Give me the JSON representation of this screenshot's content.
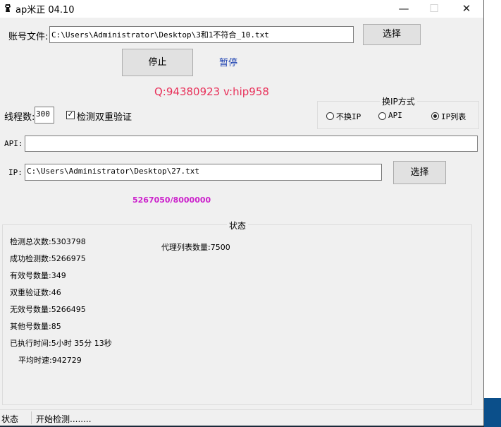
{
  "window": {
    "title": "ap米正 04.10",
    "minimize": "—",
    "maximize": "☐",
    "close": "✕"
  },
  "account": {
    "label": "账号文件:",
    "path": "C:\\Users\\Administrator\\Desktop\\3和1不符合_10.txt",
    "browse_button": "选择"
  },
  "controls": {
    "stop_button": "停止",
    "pause_link": "暂停"
  },
  "contact": "Q:94380923 v:hip958",
  "threads": {
    "label": "线程数:",
    "value": "300"
  },
  "double_verify": {
    "label": "检测双重验证",
    "checked": true
  },
  "ip_switch": {
    "title": "换IP方式",
    "options": [
      {
        "label": "不换IP",
        "selected": false
      },
      {
        "label": "API",
        "selected": false
      },
      {
        "label": "IP列表",
        "selected": true
      }
    ]
  },
  "api": {
    "label": "API:",
    "value": ""
  },
  "ip": {
    "label": "IP:",
    "path": "C:\\Users\\Administrator\\Desktop\\27.txt",
    "browse_button": "选择"
  },
  "progress_text": "5267050/8000000",
  "status_panel": {
    "title": "状态",
    "total_checks": "检测总次数:5303798",
    "success_checks": "成功检测数:5266975",
    "valid": "有效号数量:349",
    "double_verify": "双重验证数:46",
    "invalid": "无效号数量:5266495",
    "other": "其他号数量:85",
    "elapsed": "已执行时间:5小时 35分 13秒",
    "avg_speed": "平均时速:942729",
    "proxy_count": "代理列表数量:7500"
  },
  "statusbar": {
    "label": "状态",
    "message": "开始检测........"
  },
  "colors": {
    "contact": "#e8315a",
    "pause_link": "#1a3fb0",
    "progress": "#cc22cc"
  }
}
